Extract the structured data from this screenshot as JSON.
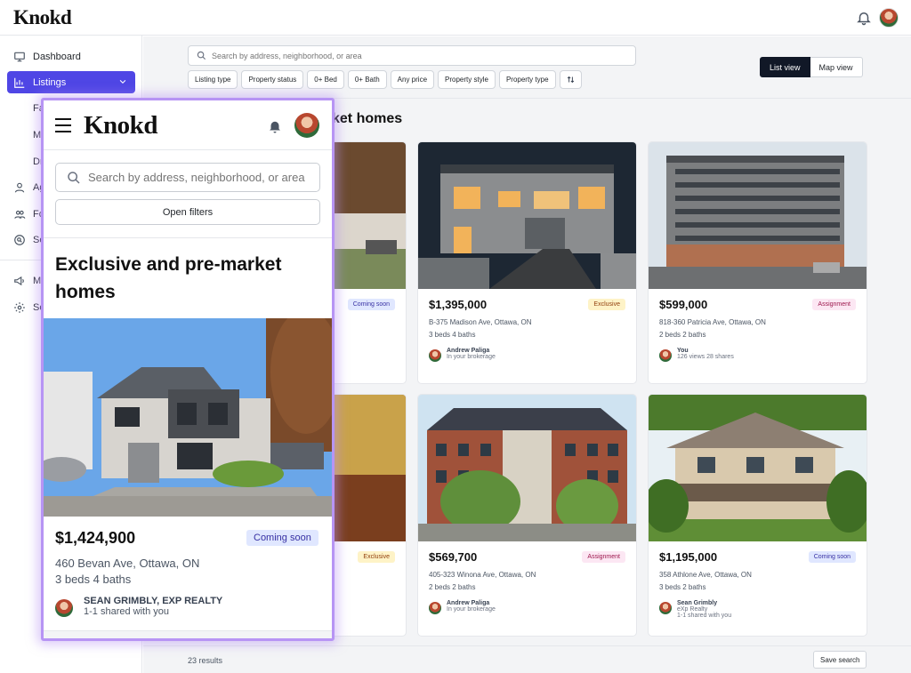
{
  "app": {
    "logo": "Knokd"
  },
  "sidebar": {
    "items": [
      {
        "label": "Dashboard"
      },
      {
        "label": "Listings"
      },
      {
        "label": "Fa"
      },
      {
        "label": "M"
      },
      {
        "label": "Dr"
      },
      {
        "label": "Ag"
      },
      {
        "label": "Fo"
      },
      {
        "label": "Se"
      },
      {
        "label": "M"
      },
      {
        "label": "Se"
      }
    ]
  },
  "search": {
    "placeholder": "Search by address, neighborhood, or area"
  },
  "filters": [
    "Listing type",
    "Property status",
    "0+ Bed",
    "0+ Bath",
    "Any price",
    "Property style",
    "Property type"
  ],
  "view": {
    "list": "List view",
    "map": "Map view"
  },
  "heading": "ket homes",
  "cards": [
    {
      "price": "",
      "badge": "Coming soon",
      "address": "",
      "beds": "",
      "agent": "",
      "agent_sub": ""
    },
    {
      "price": "$1,395,000",
      "badge": "Exclusive",
      "address": "B-375 Madison Ave, Ottawa, ON",
      "beds": "3 beds  4 baths",
      "agent": "Andrew Paliga",
      "agent_sub": "In your brokerage"
    },
    {
      "price": "$599,000",
      "badge": "Assignment",
      "address": "818-360 Patricia Ave, Ottawa, ON",
      "beds": "2 beds  2 baths",
      "agent": "You",
      "agent_sub": "126 views   28 shares"
    },
    {
      "price": "",
      "badge": "Exclusive",
      "address": "",
      "beds": "",
      "agent": "",
      "agent_sub": ""
    },
    {
      "price": "$569,700",
      "badge": "Assignment",
      "address": "405-323 Winona Ave, Ottawa, ON",
      "beds": "2 beds  2 baths",
      "agent": "Andrew Paliga",
      "agent_sub": "In your brokerage"
    },
    {
      "price": "$1,195,000",
      "badge": "Coming soon",
      "address": "358 Athlone Ave, Ottawa, ON",
      "beds": "3 beds  2 baths",
      "agent": "Sean Grimbly",
      "agent_sub": "eXp Realty",
      "agent_sub2": "1-1 shared with you"
    }
  ],
  "footer": {
    "results": "23 results",
    "save": "Save search"
  },
  "mobile": {
    "logo": "Knokd",
    "search_placeholder": "Search by address, neighborhood, or area",
    "open_filters": "Open filters",
    "title": "Exclusive and pre-market homes",
    "price": "$1,424,900",
    "badge": "Coming soon",
    "address": "460 Bevan Ave, Ottawa, ON",
    "beds": "3 beds  4 baths",
    "agent": "SEAN GRIMBLY, EXP REALTY",
    "agent_sub": "1-1 shared with you"
  },
  "colors": {
    "accent": "#4f46e5",
    "dark": "#111827",
    "highlight": "#b794f4"
  }
}
